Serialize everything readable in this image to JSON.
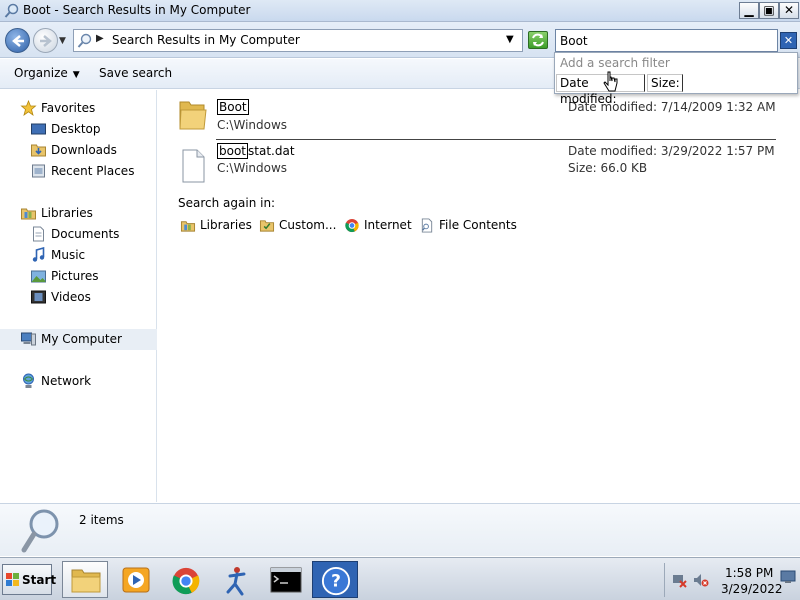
{
  "window": {
    "title": "Boot - Search Results in My Computer",
    "minimize": "▁",
    "maximize": "▣",
    "close": "✕"
  },
  "address": {
    "path": "Search Results in My Computer",
    "separator": "▶",
    "dropdown": "▼"
  },
  "search": {
    "value": "Boot",
    "clear": "✕",
    "filter_hint": "Add a search filter",
    "filters": [
      "Date modified:",
      "Size:"
    ]
  },
  "toolbar": {
    "organize": "Organize",
    "organize_caret": "▼",
    "save_search": "Save search"
  },
  "nav": {
    "favorites": "Favorites",
    "desktop": "Desktop",
    "downloads": "Downloads",
    "recent_places": "Recent Places",
    "libraries": "Libraries",
    "documents": "Documents",
    "music": "Music",
    "pictures": "Pictures",
    "videos": "Videos",
    "my_computer": "My Computer",
    "network": "Network"
  },
  "results": [
    {
      "name_match": "Boot",
      "name_rest": "",
      "path": "C:\\Windows",
      "meta1": "Date modified: 7/14/2009 1:32 AM",
      "meta2": "",
      "icon": "folder-icon"
    },
    {
      "name_match": "boot",
      "name_rest": "stat.dat",
      "path": "C:\\Windows",
      "meta1": "Date modified: 3/29/2022 1:57 PM",
      "meta2": "Size: 66.0 KB",
      "icon": "file-icon"
    }
  ],
  "search_again": {
    "label": "Search again in:",
    "locations": [
      "Libraries",
      "Custom...",
      "Internet",
      "File Contents"
    ]
  },
  "details": {
    "count": "2 items"
  },
  "taskbar": {
    "start": "Start",
    "time": "1:58 PM",
    "date": "3/29/2022",
    "apps": [
      "explorer-icon",
      "media-player-icon",
      "chrome-icon",
      "runner-app-icon",
      "command-prompt-icon",
      "help-icon"
    ]
  },
  "colors": {
    "accent": "#2f64b3",
    "selection": "#e8eef5"
  }
}
